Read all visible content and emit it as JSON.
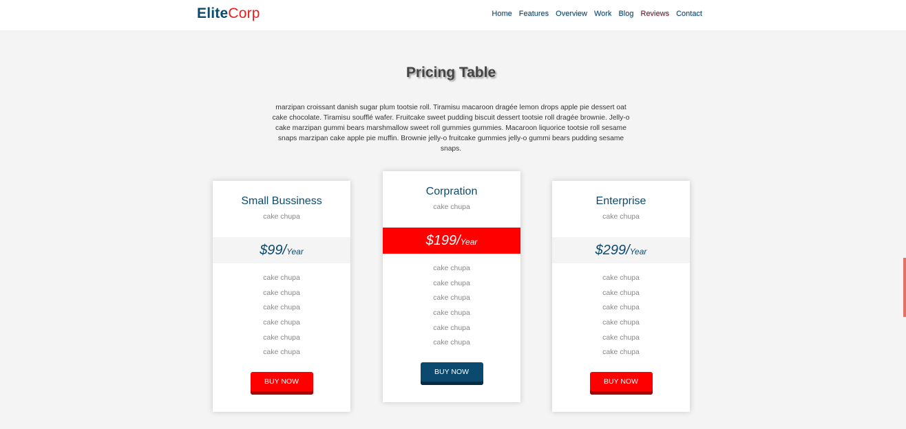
{
  "brand": {
    "part1": "Elite",
    "part2": "Corp"
  },
  "nav": {
    "items": [
      "Home",
      "Features",
      "Overview",
      "Work",
      "Blog",
      "Reviews",
      "Contact"
    ],
    "active": "Reviews"
  },
  "section": {
    "title": "Pricing Table",
    "description": "marzipan croissant danish sugar plum tootsie roll. Tiramisu macaroon dragée lemon drops apple pie dessert oat cake chocolate. Tiramisu soufflé wafer. Fruitcake sweet pudding biscuit dessert tootsie roll dragée brownie. Jelly-o cake marzipan gummi bears marshmallow sweet roll gummies gummies. Macaroon liquorice tootsie roll sesame snaps marzipan cake apple pie muffin. Brownie jelly-o fruitcake gummies jelly-o gummi bears pudding sesame snaps."
  },
  "plans": [
    {
      "name": "Small Bussiness",
      "subtitle": "cake chupa",
      "price": "$99/",
      "period": "Year",
      "features": [
        "cake chupa",
        "cake chupa",
        "cake chupa",
        "cake chupa",
        "cake chupa",
        "cake chupa"
      ],
      "button": "BUY NOW"
    },
    {
      "name": "Corpration",
      "subtitle": "cake chupa",
      "price": "$199/",
      "period": "Year",
      "features": [
        "cake chupa",
        "cake chupa",
        "cake chupa",
        "cake chupa",
        "cake chupa",
        "cake chupa"
      ],
      "button": "BUY NOW"
    },
    {
      "name": "Enterprise",
      "subtitle": "cake chupa",
      "price": "$299/",
      "period": "Year",
      "features": [
        "cake chupa",
        "cake chupa",
        "cake chupa",
        "cake chupa",
        "cake chupa",
        "cake chupa"
      ],
      "button": "BUY NOW"
    }
  ],
  "colors": {
    "brand_blue": "#0b4a6e",
    "brand_red": "#ff0000",
    "background": "#f4f4f4"
  }
}
